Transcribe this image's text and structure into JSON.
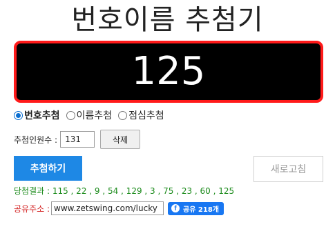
{
  "page": {
    "title": "번호이름 추첨기"
  },
  "display": {
    "number": "125",
    "border_color": "#ff1a1a",
    "background": "#000000"
  },
  "modes": [
    {
      "label": "번호추첨",
      "checked": true
    },
    {
      "label": "이름추첨",
      "checked": false
    },
    {
      "label": "점심추첨",
      "checked": false
    }
  ],
  "count": {
    "label": "추첨인원수 :",
    "value": "131",
    "delete_label": "삭제"
  },
  "buttons": {
    "draw_label": "추첨하기",
    "refresh_label": "새로고침",
    "accent": "#1e88e5"
  },
  "result": {
    "text": "당첨결과 : 115 , 22 , 9 , 54 , 129 , 3 , 75 , 23 , 60 , 125"
  },
  "share": {
    "label": "공유주소 :",
    "url": "www.zetswing.com/lucky",
    "fb_icon_glyph": "f",
    "fb_label": "공유 218개"
  }
}
